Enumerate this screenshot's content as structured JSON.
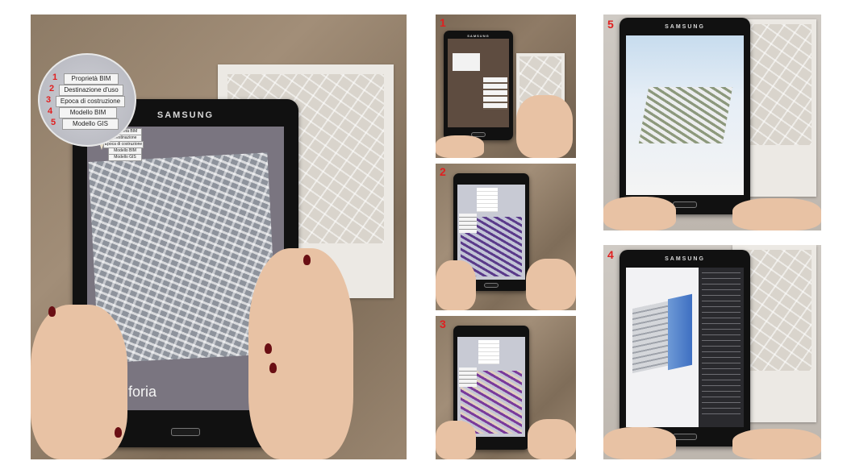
{
  "main_photo": {
    "tablet_brand": "SAMSUNG",
    "vuforia_label": "vuforia",
    "magnifier_menu": [
      {
        "num": "1",
        "label": "Proprietà BIM"
      },
      {
        "num": "2",
        "label": "Destinazione d'uso"
      },
      {
        "num": "3",
        "label": "Epoca di costruzione"
      },
      {
        "num": "4",
        "label": "Modello BIM"
      },
      {
        "num": "5",
        "label": "Modello GIS"
      }
    ],
    "screen_menu": [
      {
        "label": "Proprietà BIM"
      },
      {
        "label": "Destinazione d'uso"
      },
      {
        "label": "Epoca di costruzione"
      },
      {
        "label": "Modello BIM"
      },
      {
        "label": "Modello GIS"
      }
    ]
  },
  "panels": [
    {
      "badge": "1",
      "tablet_brand": "SAMSUNG"
    },
    {
      "badge": "2",
      "tablet_brand": ""
    },
    {
      "badge": "3",
      "tablet_brand": ""
    },
    {
      "badge": "5",
      "tablet_brand": "SAMSUNG"
    },
    {
      "badge": "4",
      "tablet_brand": "SAMSUNG"
    }
  ],
  "colors": {
    "badge": "#e02020",
    "nail": "#6a0f14",
    "skin": "#e8c2a4"
  }
}
